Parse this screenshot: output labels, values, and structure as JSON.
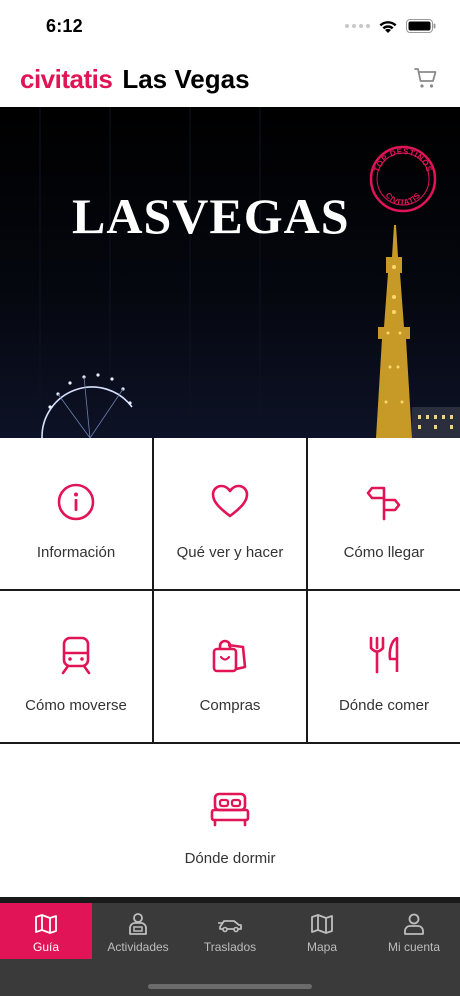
{
  "status": {
    "time": "6:12"
  },
  "header": {
    "brand": "civitatis",
    "city": "Las Vegas",
    "cart_icon": "cart-icon"
  },
  "hero": {
    "title": "LASVEGAS",
    "badge_top": "TOP DESTINOS",
    "badge_bottom": "CIVITATIS"
  },
  "tiles": [
    {
      "label": "Información",
      "icon": "info-icon"
    },
    {
      "label": "Qué ver y hacer",
      "icon": "heart-icon"
    },
    {
      "label": "Cómo llegar",
      "icon": "signpost-icon"
    },
    {
      "label": "Cómo moverse",
      "icon": "train-icon"
    },
    {
      "label": "Compras",
      "icon": "shopping-bags-icon"
    },
    {
      "label": "Dónde comer",
      "icon": "fork-knife-icon"
    },
    {
      "label": "Dónde dormir",
      "icon": "bed-icon"
    }
  ],
  "nav": [
    {
      "label": "Guía",
      "icon": "map-guide-icon",
      "active": true
    },
    {
      "label": "Actividades",
      "icon": "activities-icon",
      "active": false
    },
    {
      "label": "Traslados",
      "icon": "transfer-car-icon",
      "active": false
    },
    {
      "label": "Mapa",
      "icon": "map-icon",
      "active": false
    },
    {
      "label": "Mi cuenta",
      "icon": "user-icon",
      "active": false
    }
  ],
  "colors": {
    "accent": "#e01457",
    "nav_bg": "#3a3a3a",
    "nav_text": "#bdbdbd"
  }
}
